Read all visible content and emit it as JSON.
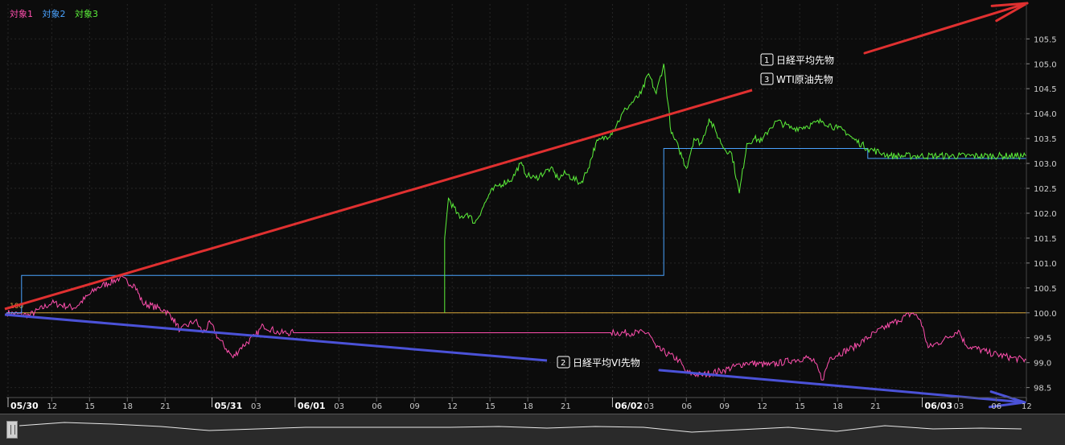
{
  "legend": [
    {
      "label": "対象1",
      "color": "#ff4fae"
    },
    {
      "label": "対象2",
      "color": "#4aa3ff"
    },
    {
      "label": "対象3",
      "color": "#5cf03a"
    }
  ],
  "colors": {
    "background": "#0c0c0c",
    "grid": "#262626",
    "baseline": "#d8a63a",
    "trend_up": "#e03030",
    "trend_down": "#4b52d8",
    "navigator_bg": "#2a2a2a"
  },
  "chart_data": {
    "type": "line",
    "ylim": [
      98.3,
      106.2
    ],
    "yticks": [
      "98.5",
      "99.0",
      "99.5",
      "100.0",
      "100.5",
      "101.0",
      "101.5",
      "102.0",
      "102.5",
      "103.0",
      "103.5",
      "104.0",
      "104.5",
      "105.0",
      "105.5"
    ],
    "x_start": "05/30",
    "x_tick_labels": [
      {
        "label": "05/30",
        "major": true
      },
      {
        "label": "12",
        "major": false
      },
      {
        "label": "15",
        "major": false
      },
      {
        "label": "18",
        "major": false
      },
      {
        "label": "21",
        "major": false
      },
      {
        "label": "05/31",
        "major": true
      },
      {
        "label": "03",
        "major": false
      },
      {
        "label": "06/01",
        "major": true
      },
      {
        "label": "03",
        "major": false
      },
      {
        "label": "06",
        "major": false
      },
      {
        "label": "09",
        "major": false
      },
      {
        "label": "12",
        "major": false
      },
      {
        "label": "15",
        "major": false
      },
      {
        "label": "18",
        "major": false
      },
      {
        "label": "21",
        "major": false
      },
      {
        "label": "06/02",
        "major": true
      },
      {
        "label": "03",
        "major": false
      },
      {
        "label": "06",
        "major": false
      },
      {
        "label": "09",
        "major": false
      },
      {
        "label": "12",
        "major": false
      },
      {
        "label": "15",
        "major": false
      },
      {
        "label": "18",
        "major": false
      },
      {
        "label": "21",
        "major": false
      },
      {
        "label": "06/03",
        "major": true
      },
      {
        "label": "03",
        "major": false
      },
      {
        "label": "06",
        "major": false
      },
      {
        "label": "12",
        "major": false
      }
    ],
    "baseline": {
      "value": 100,
      "label": "100"
    },
    "series": [
      {
        "name": "対象1",
        "color": "#ff4fae",
        "label": "日経平均VI先物",
        "label_no": "2",
        "points": [
          [
            0,
            100
          ],
          [
            3,
            99.95
          ],
          [
            6,
            100.2
          ],
          [
            9,
            100.1
          ],
          [
            12,
            100.5
          ],
          [
            15,
            100.7
          ],
          [
            17,
            100.55
          ],
          [
            18,
            100.2
          ],
          [
            21,
            100.05
          ],
          [
            22,
            99.9
          ],
          [
            23,
            99.65
          ],
          [
            25,
            99.85
          ],
          [
            26,
            99.6
          ],
          [
            27,
            99.8
          ],
          [
            28,
            99.5
          ],
          [
            30,
            99.1
          ],
          [
            31,
            99.3
          ],
          [
            33,
            99.55
          ],
          [
            34,
            99.75
          ],
          [
            36,
            99.6
          ],
          [
            38,
            99.6
          ],
          [
            80,
            99.6
          ],
          [
            85,
            99.6
          ],
          [
            86,
            99.3
          ],
          [
            89,
            99.05
          ],
          [
            90,
            98.8
          ],
          [
            92,
            98.75
          ],
          [
            95,
            98.85
          ],
          [
            98,
            99.0
          ],
          [
            101,
            98.95
          ],
          [
            104,
            99.05
          ],
          [
            106,
            99.1
          ],
          [
            107,
            99.0
          ],
          [
            108,
            98.65
          ],
          [
            109,
            99.1
          ],
          [
            112,
            99.3
          ],
          [
            115,
            99.6
          ],
          [
            118,
            99.85
          ],
          [
            120,
            100.0
          ],
          [
            121,
            99.85
          ],
          [
            122,
            99.3
          ],
          [
            124,
            99.45
          ],
          [
            126,
            99.65
          ],
          [
            127,
            99.35
          ],
          [
            130,
            99.2
          ],
          [
            133,
            99.1
          ],
          [
            135,
            99.05
          ]
        ]
      },
      {
        "name": "対象2",
        "color": "#4aa3ff",
        "label": "日経平均先物",
        "label_no": "1",
        "points": [
          [
            0,
            100
          ],
          [
            2,
            100
          ],
          [
            2,
            100.75
          ],
          [
            87,
            100.75
          ],
          [
            87,
            103.3
          ],
          [
            90,
            103.3
          ],
          [
            114,
            103.3
          ],
          [
            114,
            103.1
          ],
          [
            135,
            103.1
          ]
        ]
      },
      {
        "name": "対象3",
        "color": "#5cf03a",
        "label": "WTI原油先物",
        "label_no": "3",
        "points": [
          [
            58,
            100
          ],
          [
            58,
            101.5
          ],
          [
            58.5,
            102.3
          ],
          [
            60,
            101.9
          ],
          [
            61,
            102.0
          ],
          [
            62,
            101.8
          ],
          [
            63,
            102.1
          ],
          [
            64,
            102.4
          ],
          [
            65,
            102.55
          ],
          [
            67,
            102.7
          ],
          [
            68,
            103.0
          ],
          [
            69,
            102.75
          ],
          [
            70,
            102.7
          ],
          [
            72,
            102.9
          ],
          [
            73,
            102.7
          ],
          [
            74,
            102.8
          ],
          [
            76,
            102.6
          ],
          [
            77,
            102.9
          ],
          [
            78,
            103.4
          ],
          [
            80,
            103.6
          ],
          [
            82,
            104.1
          ],
          [
            84,
            104.4
          ],
          [
            85,
            104.8
          ],
          [
            86,
            104.4
          ],
          [
            87,
            105.0
          ],
          [
            88,
            103.6
          ],
          [
            89,
            103.3
          ],
          [
            90,
            102.9
          ],
          [
            91,
            103.5
          ],
          [
            92,
            103.4
          ],
          [
            93,
            103.9
          ],
          [
            94,
            103.6
          ],
          [
            95,
            103.3
          ],
          [
            96,
            103.2
          ],
          [
            97,
            102.4
          ],
          [
            98,
            103.4
          ],
          [
            99,
            103.5
          ],
          [
            100,
            103.45
          ],
          [
            101,
            103.7
          ],
          [
            102,
            103.85
          ],
          [
            104,
            103.7
          ],
          [
            106,
            103.75
          ],
          [
            108,
            103.85
          ],
          [
            110,
            103.7
          ],
          [
            111,
            103.65
          ],
          [
            112,
            103.5
          ],
          [
            114,
            103.3
          ],
          [
            116,
            103.2
          ],
          [
            117,
            103.15
          ],
          [
            120,
            103.15
          ],
          [
            135,
            103.15
          ]
        ]
      }
    ]
  }
}
